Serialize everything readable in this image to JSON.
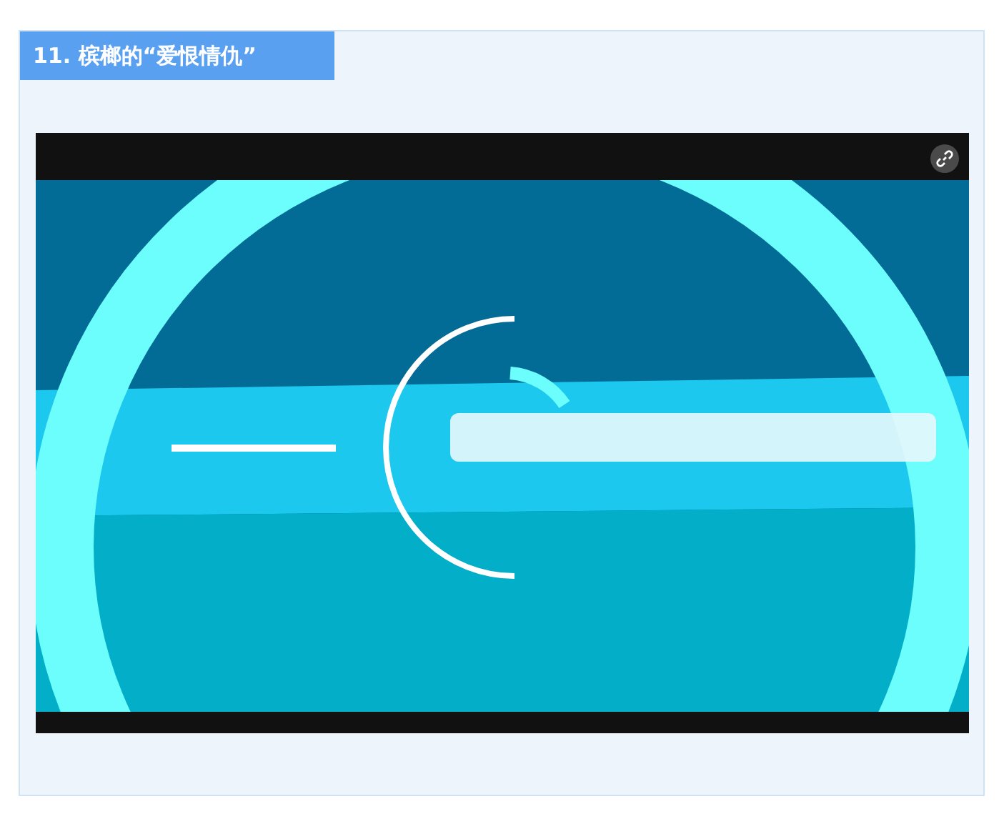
{
  "section": {
    "heading": "11. 槟榔的“爱恨情仇”"
  }
}
